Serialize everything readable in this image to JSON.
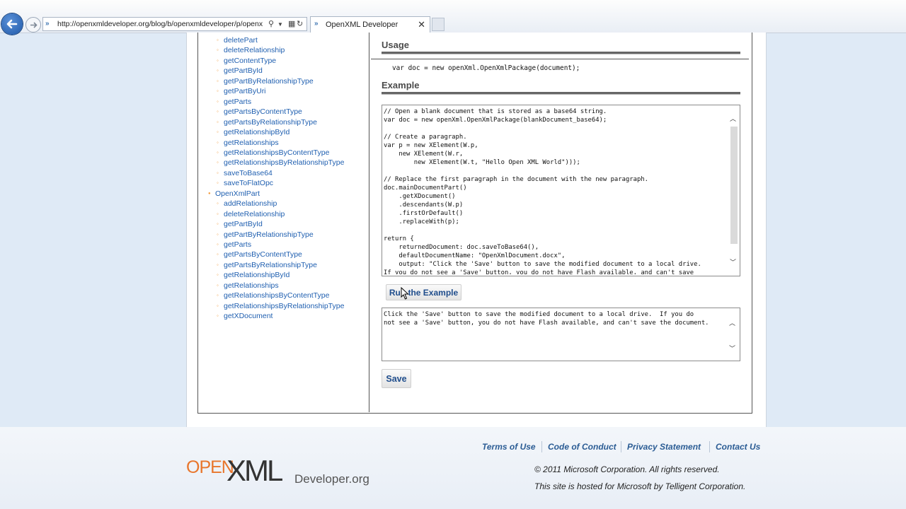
{
  "browser": {
    "address_url": "http://openxmldeveloper.org/blog/b/openxmldeveloper/p/openx",
    "tab_title": "OpenXML Developer",
    "tab_close": "✕"
  },
  "sidebar": {
    "items": [
      {
        "label": "deletePart",
        "level": 2
      },
      {
        "label": "deleteRelationship",
        "level": 2
      },
      {
        "label": "getContentType",
        "level": 2
      },
      {
        "label": "getPartById",
        "level": 2
      },
      {
        "label": "getPartByRelationshipType",
        "level": 2
      },
      {
        "label": "getPartByUri",
        "level": 2
      },
      {
        "label": "getParts",
        "level": 2
      },
      {
        "label": "getPartsByContentType",
        "level": 2
      },
      {
        "label": "getPartsByRelationshipType",
        "level": 2
      },
      {
        "label": "getRelationshipById",
        "level": 2
      },
      {
        "label": "getRelationships",
        "level": 2
      },
      {
        "label": "getRelationshipsByContentType",
        "level": 2
      },
      {
        "label": "getRelationshipsByRelationshipType",
        "level": 2
      },
      {
        "label": "saveToBase64",
        "level": 2
      },
      {
        "label": "saveToFlatOpc",
        "level": 2
      },
      {
        "label": "OpenXmlPart",
        "level": 1
      },
      {
        "label": "addRelationship",
        "level": 2
      },
      {
        "label": "deleteRelationship",
        "level": 2
      },
      {
        "label": "getPartById",
        "level": 2
      },
      {
        "label": "getPartByRelationshipType",
        "level": 2
      },
      {
        "label": "getParts",
        "level": 2
      },
      {
        "label": "getPartsByContentType",
        "level": 2
      },
      {
        "label": "getPartsByRelationshipType",
        "level": 2
      },
      {
        "label": "getRelationshipById",
        "level": 2
      },
      {
        "label": "getRelationships",
        "level": 2
      },
      {
        "label": "getRelationshipsByContentType",
        "level": 2
      },
      {
        "label": "getRelationshipsByRelationshipType",
        "level": 2
      },
      {
        "label": "getXDocument",
        "level": 2
      }
    ]
  },
  "main": {
    "usage_heading": "Usage",
    "usage_code": "var doc = new openXml.OpenXmlPackage(document);",
    "example_heading": "Example",
    "example_code": "// Open a blank document that is stored as a base64 string.\nvar doc = new openXml.OpenXmlPackage(blankDocument_base64);\n\n// Create a paragraph.\nvar p = new XElement(W.p,\n    new XElement(W.r,\n        new XElement(W.t, \"Hello Open XML World\")));\n\n// Replace the first paragraph in the document with the new paragraph.\ndoc.mainDocumentPart()\n    .getXDocument()\n    .descendants(W.p)\n    .firstOrDefault()\n    .replaceWith(p);\n\nreturn {\n    returnedDocument: doc.saveToBase64(),\n    defaultDocumentName: \"OpenXmlDocument.docx\",\n    output: \"Click the 'Save' button to save the modified document to a local drive.\nIf you do not see a 'Save' button, you do not have Flash available, and can't save",
    "run_button": "Run the Example",
    "output_text": "Click the 'Save' button to save the modified document to a local drive.  If you do\nnot see a 'Save' button, you do not have Flash available, and can't save the document.",
    "save_button": "Save"
  },
  "footer": {
    "links": [
      "Terms of Use",
      "Code of Conduct",
      "Privacy Statement",
      "Contact Us"
    ],
    "copyright": "© 2011 Microsoft Corporation. All rights reserved.",
    "hosted": "This site is hosted for Microsoft by Telligent Corporation.",
    "logo_open": "OPEN",
    "logo_xml": "XML",
    "logo_developer": "Developer.org"
  },
  "colors": {
    "link": "#1f5fb0",
    "bullet": "#f39c3d",
    "logo_orange": "#e8762c"
  }
}
